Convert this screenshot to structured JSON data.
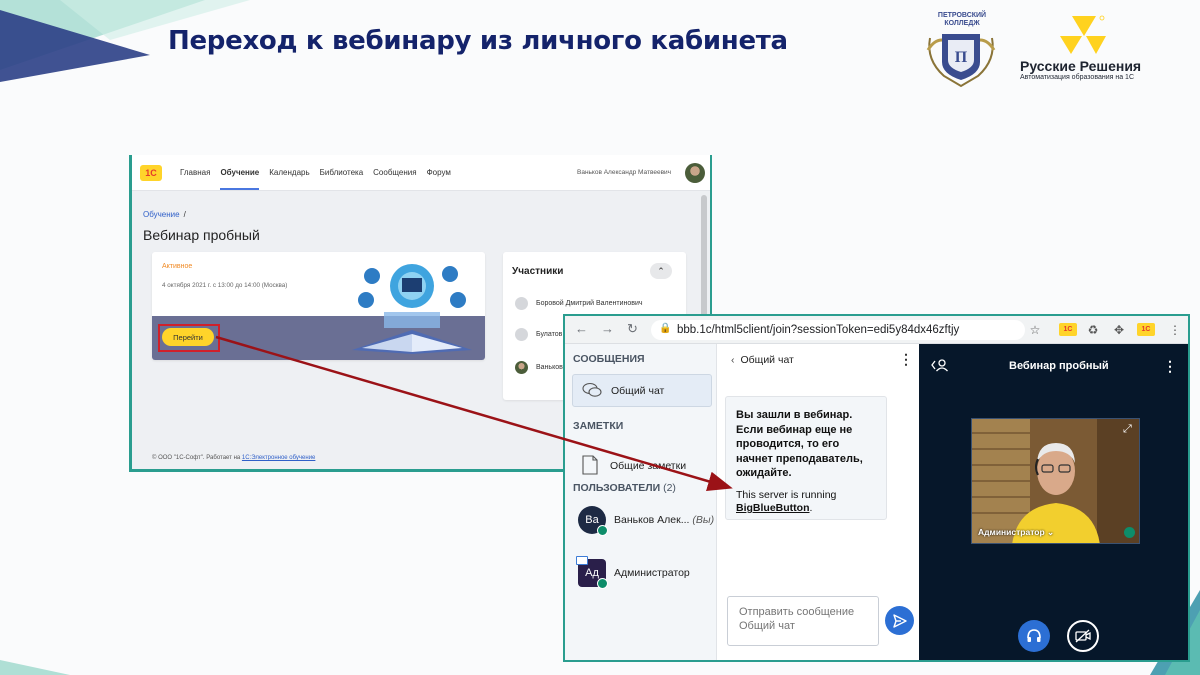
{
  "slide": {
    "title": "Переход к вебинару из личного кабинета"
  },
  "logos": {
    "college": {
      "name_line1": "ПЕТРОВСКИЙ",
      "name_line2": "КОЛЛЕДЖ"
    },
    "rr": {
      "name": "Русские Решения",
      "tagline": "Автоматизация образования на 1С"
    }
  },
  "lms": {
    "logo": "1С",
    "nav": [
      "Главная",
      "Обучение",
      "Календарь",
      "Библиотека",
      "Сообщения",
      "Форум"
    ],
    "active_nav": "Обучение",
    "user_name": "Ваньков Александр Матвеевич",
    "breadcrumb": "Обучение",
    "breadcrumb_sep": "/",
    "page_title": "Вебинар пробный",
    "card": {
      "status": "Активное",
      "date": "4 октября 2021 г. с 13:00 до 14:00 (Москва)",
      "go_button": "Перейти"
    },
    "participants": {
      "title": "Участники",
      "toggle": "⌃",
      "items": [
        "Боровой Дмитрий Валентинович",
        "Булатов",
        "Ваньков"
      ]
    },
    "footer_text": "© ООО \"1С-Софт\". Работает на",
    "footer_link": "1С:Электронное обучение"
  },
  "bbb": {
    "url": "bbb.1c/html5client/join?sessionToken=edi5y84dx46zftjy",
    "sections": {
      "messages": "СООБЩЕНИЯ",
      "notes": "ЗАМЕТКИ",
      "users": "ПОЛЬЗОВАТЕЛИ",
      "users_count": "(2)"
    },
    "public_chat": "Общий чат",
    "shared_notes": "Общие заметки",
    "users": [
      {
        "initials": "Ва",
        "name": "Ваньков Алек...",
        "you": "(Вы)"
      },
      {
        "initials": "Ад",
        "name": "Администратор",
        "you": ""
      }
    ],
    "chat": {
      "back": "‹",
      "title": "Общий чат",
      "message_ru": "Вы зашли в вебинар. Если вебинар еще не проводится, то его начнет преподаватель, ожидайте.",
      "message_en_prefix": "This server is running",
      "message_en_link": "BigBlueButton",
      "message_en_suffix": ".",
      "input_placeholder": "Отправить сообщение Общий чат"
    },
    "video": {
      "title": "Вебинар пробный",
      "camera_label": "Администратор ⌄"
    },
    "colors": {
      "accent": "#2c6fd4",
      "video_bg": "#06172a"
    }
  },
  "arrow_color": "#9b1217"
}
